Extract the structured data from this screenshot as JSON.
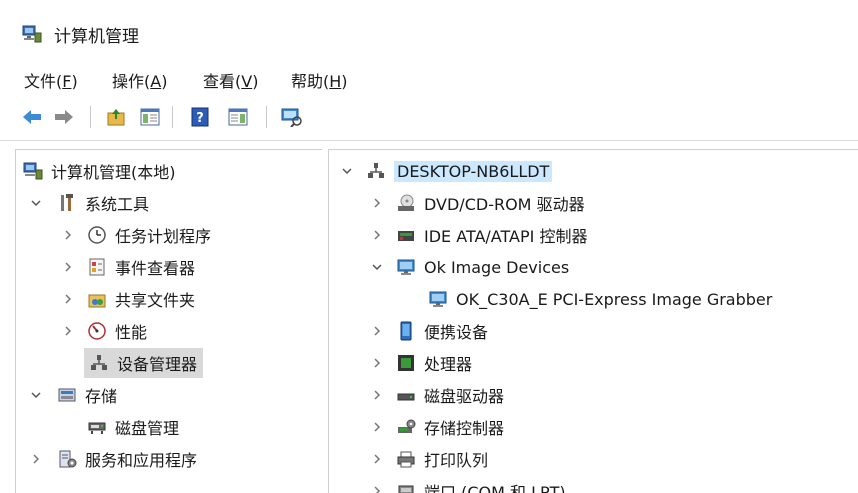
{
  "window": {
    "title": "计算机管理"
  },
  "menu": [
    {
      "label": "文件(",
      "key": "F",
      "tail": ")"
    },
    {
      "label": "操作(",
      "key": "A",
      "tail": ")"
    },
    {
      "label": "查看(",
      "key": "V",
      "tail": ")"
    },
    {
      "label": "帮助(",
      "key": "H",
      "tail": ")"
    }
  ],
  "toolbar": {
    "buttons": [
      "back-icon",
      "forward-icon",
      "up-folder-icon",
      "show-hide-console-tree-icon",
      "help-icon",
      "show-hide-action-pane-icon",
      "scan-hardware-icon"
    ]
  },
  "left_tree": {
    "root": "计算机管理(本地)",
    "system_tools": "系统工具",
    "task_scheduler": "任务计划程序",
    "event_viewer": "事件查看器",
    "shared_folders": "共享文件夹",
    "performance": "性能",
    "device_manager": "设备管理器",
    "storage": "存储",
    "disk_management": "磁盘管理",
    "services_apps": "服务和应用程序"
  },
  "right_tree": {
    "root": "DESKTOP-NB6LLDT",
    "dvd": "DVD/CD-ROM 驱动器",
    "ide": "IDE ATA/ATAPI 控制器",
    "ok_image": "Ok Image Devices",
    "ok_child": "OK_C30A_E PCI-Express Image Grabber",
    "portable": "便携设备",
    "processor": "处理器",
    "disk_drives": "磁盘驱动器",
    "storage_ctrl": "存储控制器",
    "print_queue": "打印队列",
    "ports": "端口 (COM 和 LPT)"
  }
}
